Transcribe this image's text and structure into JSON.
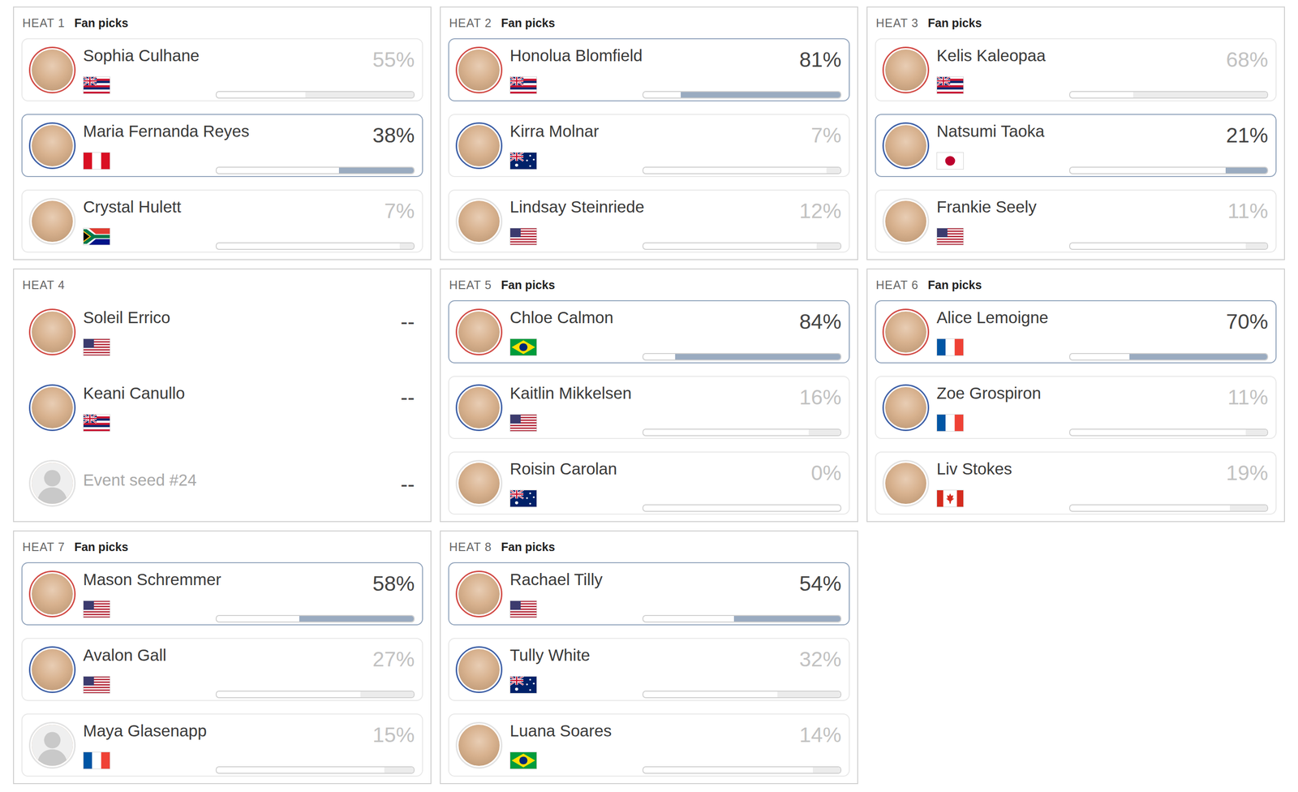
{
  "heats": [
    {
      "title": "HEAT 1",
      "label": "Fan picks",
      "kind": "picks",
      "surfers": [
        {
          "name": "Sophia Culhane",
          "flag": "hawaii",
          "photo": true,
          "color": "#d24b46",
          "pick": "55%",
          "level": 0.55,
          "selected": false,
          "disabled": false
        },
        {
          "name": "Maria Fernanda Reyes",
          "flag": "peru",
          "photo": true,
          "color": "#3d5fa6",
          "pick": "38%",
          "level": 0.38,
          "selected": true,
          "disabled": false
        },
        {
          "name": "Crystal Hulett",
          "flag": "south-africa",
          "photo": true,
          "color": "#e2e2e2",
          "pick": "7%",
          "level": 0.07,
          "selected": false,
          "disabled": false
        }
      ]
    },
    {
      "title": "HEAT 2",
      "label": "Fan picks",
      "kind": "picks",
      "surfers": [
        {
          "name": "Honolua Blomfield",
          "flag": "hawaii",
          "photo": true,
          "color": "#d24b46",
          "pick": "81%",
          "level": 0.81,
          "selected": true,
          "disabled": false
        },
        {
          "name": "Kirra Molnar",
          "flag": "australia",
          "photo": true,
          "color": "#3d5fa6",
          "pick": "7%",
          "level": 0.07,
          "selected": false,
          "disabled": false
        },
        {
          "name": "Lindsay Steinriede",
          "flag": "usa",
          "photo": true,
          "color": "#e2e2e2",
          "pick": "12%",
          "level": 0.12,
          "selected": false,
          "disabled": false
        }
      ]
    },
    {
      "title": "HEAT 3",
      "label": "Fan picks",
      "kind": "picks",
      "surfers": [
        {
          "name": "Kelis Kaleopaa",
          "flag": "hawaii",
          "photo": true,
          "color": "#d24b46",
          "pick": "68%",
          "level": 0.68,
          "selected": false,
          "disabled": false
        },
        {
          "name": "Natsumi Taoka",
          "flag": "japan",
          "photo": true,
          "color": "#3d5fa6",
          "pick": "21%",
          "level": 0.21,
          "selected": true,
          "disabled": false
        },
        {
          "name": "Frankie Seely",
          "flag": "usa",
          "photo": true,
          "color": "#e2e2e2",
          "pick": "11%",
          "level": 0.11,
          "selected": false,
          "disabled": false
        }
      ]
    },
    {
      "title": "HEAT 4",
      "label": null,
      "kind": "pending",
      "surfers": [
        {
          "name": "Soleil Errico",
          "flag": "usa",
          "photo": true,
          "color": "#d24b46",
          "pick": "--",
          "level": null,
          "selected": false,
          "disabled": false
        },
        {
          "name": "Keani Canullo",
          "flag": "hawaii",
          "photo": true,
          "color": "#3d5fa6",
          "pick": "--",
          "level": null,
          "selected": false,
          "disabled": false
        },
        {
          "name": "Event seed #24",
          "flag": null,
          "photo": false,
          "color": "#e2e2e2",
          "pick": "--",
          "level": null,
          "selected": false,
          "disabled": true
        }
      ]
    },
    {
      "title": "HEAT 5",
      "label": "Fan picks",
      "kind": "picks",
      "surfers": [
        {
          "name": "Chloe Calmon",
          "flag": "brazil",
          "photo": true,
          "color": "#d24b46",
          "pick": "84%",
          "level": 0.84,
          "selected": true,
          "disabled": false
        },
        {
          "name": "Kaitlin Mikkelsen",
          "flag": "usa",
          "photo": true,
          "color": "#3d5fa6",
          "pick": "16%",
          "level": 0.16,
          "selected": false,
          "disabled": false
        },
        {
          "name": "Roisin Carolan",
          "flag": "australia",
          "photo": true,
          "color": "#e2e2e2",
          "pick": "0%",
          "level": 0,
          "selected": false,
          "disabled": false
        }
      ]
    },
    {
      "title": "HEAT 6",
      "label": "Fan picks",
      "kind": "picks",
      "surfers": [
        {
          "name": "Alice Lemoigne",
          "flag": "france",
          "photo": true,
          "color": "#d24b46",
          "pick": "70%",
          "level": 0.7,
          "selected": true,
          "disabled": false
        },
        {
          "name": "Zoe Grospiron",
          "flag": "france",
          "photo": true,
          "color": "#3d5fa6",
          "pick": "11%",
          "level": 0.11,
          "selected": false,
          "disabled": false
        },
        {
          "name": "Liv Stokes",
          "flag": "canada",
          "photo": true,
          "color": "#e2e2e2",
          "pick": "19%",
          "level": 0.19,
          "selected": false,
          "disabled": false
        }
      ]
    },
    {
      "title": "HEAT 7",
      "label": "Fan picks",
      "kind": "picks",
      "surfers": [
        {
          "name": "Mason Schremmer",
          "flag": "usa",
          "photo": true,
          "color": "#d24b46",
          "pick": "58%",
          "level": 0.58,
          "selected": true,
          "disabled": false
        },
        {
          "name": "Avalon Gall",
          "flag": "usa",
          "photo": true,
          "color": "#3d5fa6",
          "pick": "27%",
          "level": 0.27,
          "selected": false,
          "disabled": false
        },
        {
          "name": "Maya Glasenapp",
          "flag": "france",
          "photo": false,
          "color": "#e2e2e2",
          "pick": "15%",
          "level": 0.15,
          "selected": false,
          "disabled": false
        }
      ]
    },
    {
      "title": "HEAT 8",
      "label": "Fan picks",
      "kind": "picks",
      "surfers": [
        {
          "name": "Rachael Tilly",
          "flag": "usa",
          "photo": true,
          "color": "#d24b46",
          "pick": "54%",
          "level": 0.54,
          "selected": true,
          "disabled": false
        },
        {
          "name": "Tully White",
          "flag": "australia",
          "photo": true,
          "color": "#3d5fa6",
          "pick": "32%",
          "level": 0.32,
          "selected": false,
          "disabled": false
        },
        {
          "name": "Luana Soares",
          "flag": "brazil",
          "photo": true,
          "color": "#e2e2e2",
          "pick": "14%",
          "level": 0.14,
          "selected": false,
          "disabled": false
        }
      ]
    }
  ]
}
